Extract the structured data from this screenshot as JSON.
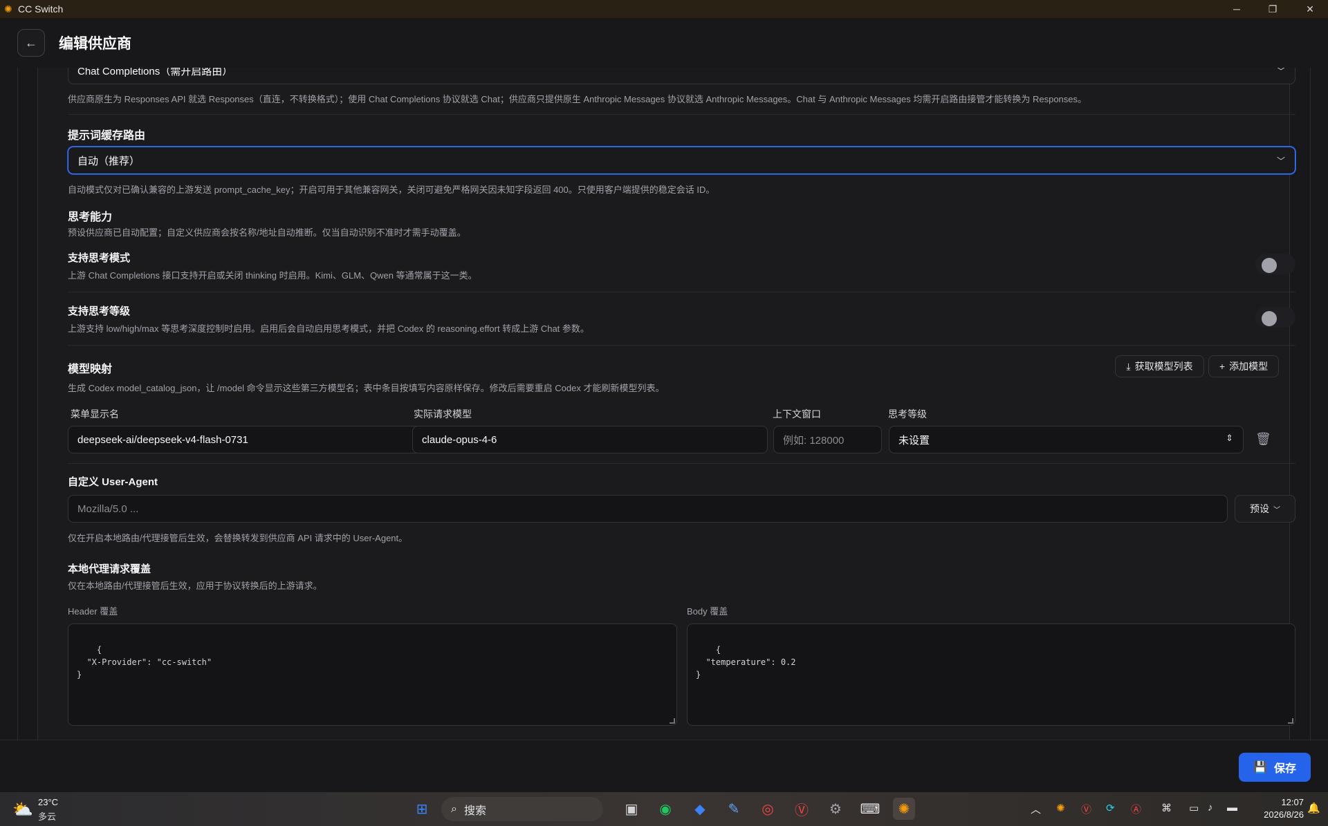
{
  "window": {
    "title": "CC Switch",
    "minimize": "─",
    "maximize": "❐",
    "close": "✕"
  },
  "header": {
    "back_icon": "←",
    "title": "编辑供应商"
  },
  "api_format": {
    "selected": "Chat Completions（需开启路由）",
    "hint": "供应商原生为 Responses API 就选 Responses（直连，不转换格式）；使用 Chat Completions 协议就选 Chat；供应商只提供原生 Anthropic Messages 协议就选 Anthropic Messages。Chat 与 Anthropic Messages 均需开启路由接管才能转换为 Responses。"
  },
  "prompt_cache": {
    "label": "提示词缓存路由",
    "selected": "自动（推荐）",
    "hint": "自动模式仅对已确认兼容的上游发送 prompt_cache_key；开启可用于其他兼容网关，关闭可避免严格网关因未知字段返回 400。只使用客户端提供的稳定会话 ID。"
  },
  "thinking": {
    "label": "思考能力",
    "hint": "预设供应商已自动配置；自定义供应商会按名称/地址自动推断。仅当自动识别不准时才需手动覆盖。",
    "mode_label": "支持思考模式",
    "mode_hint": "上游 Chat Completions 接口支持开启或关闭 thinking 时启用。Kimi、GLM、Qwen 等通常属于这一类。",
    "mode_enabled": false,
    "level_label": "支持思考等级",
    "level_hint": "上游支持 low/high/max 等思考深度控制时启用。启用后会自动启用思考模式，并把 Codex 的 reasoning.effort 转成上游 Chat 参数。",
    "level_enabled": false
  },
  "model_mapping": {
    "label": "模型映射",
    "hint": "生成 Codex model_catalog_json，让 /model 命令显示这些第三方模型名；表中条目按填写内容原样保存。修改后需要重启 Codex 才能刷新模型列表。",
    "fetch_button": "获取模型列表",
    "add_button": "添加模型",
    "columns": [
      "菜单显示名",
      "实际请求模型",
      "上下文窗口",
      "思考等级"
    ],
    "rows": [
      {
        "display_name": "deepseek-ai/deepseek-v4-flash-0731",
        "request_model": "claude-opus-4-6",
        "context_placeholder": "例如: 128000",
        "thinking_level": "未设置"
      }
    ]
  },
  "user_agent": {
    "label": "自定义 User-Agent",
    "placeholder": "Mozilla/5.0 ...",
    "preset_button": "预设",
    "hint": "仅在开启本地路由/代理接管后生效，会替换转发到供应商 API 请求中的 User-Agent。"
  },
  "overrides": {
    "label": "本地代理请求覆盖",
    "hint": "仅在本地路由/代理接管后生效，应用于协议转换后的上游请求。",
    "header_label": "Header 覆盖",
    "header_value": "{\n  \"X-Provider\": \"cc-switch\"\n}",
    "body_label": "Body 覆盖",
    "body_value": "{\n  \"temperature\": 0.2\n}"
  },
  "footer": {
    "save_label": "保存"
  },
  "taskbar": {
    "weather_temp": "23°C",
    "weather_desc": "多云",
    "search_placeholder": "搜索",
    "time": "12:07",
    "date": "2026/8/26"
  },
  "colors": {
    "accent": "#2563eb",
    "focus": "#3b82f6",
    "background": "#18181b"
  }
}
